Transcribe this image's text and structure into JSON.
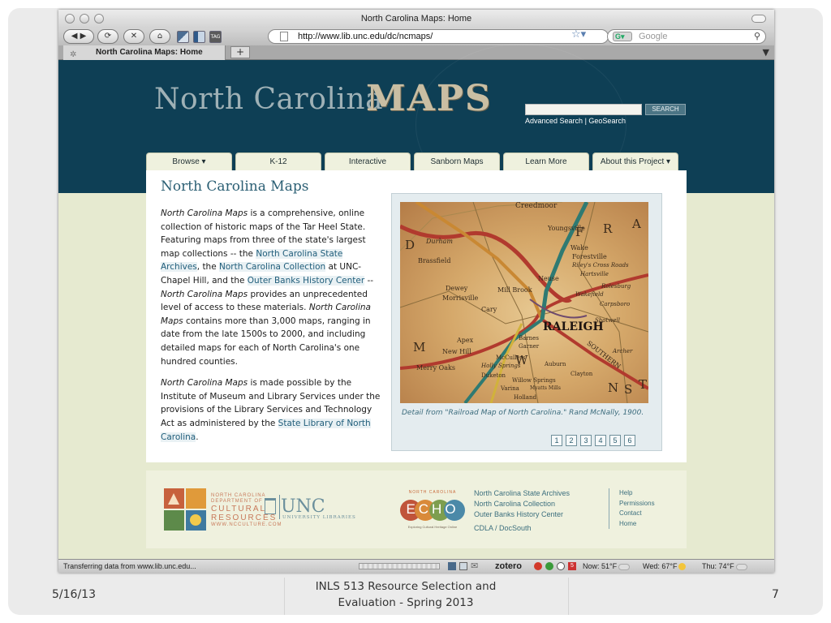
{
  "browser": {
    "window_title": "North Carolina Maps: Home",
    "url": "http://www.lib.unc.edu/dc/ncmaps/",
    "search_placeholder": "Google",
    "tab_title": "North Carolina Maps: Home",
    "new_tab_label": "+"
  },
  "header": {
    "logo_text": "North Carolina",
    "logo_maps": "MAPS",
    "search_button": "SEARCH",
    "advanced_search": "Advanced Search",
    "separator": "|",
    "geosearch": "GeoSearch"
  },
  "nav": {
    "tabs": [
      {
        "label": "Browse ▾"
      },
      {
        "label": "K-12"
      },
      {
        "label": "Interactive"
      },
      {
        "label": "Sanborn Maps"
      },
      {
        "label": "Learn More"
      },
      {
        "label": "About this Project ▾"
      }
    ]
  },
  "main": {
    "title": "North Carolina Maps",
    "p1_s1_i": "North Carolina Maps",
    "p1_s1": " is a comprehensive, online collection of historic maps of the Tar Heel State. Featuring maps from three of the state's largest map collections -- the ",
    "link_archives": "North Carolina State Archives",
    "p1_s2": ", the ",
    "link_collection": "North Carolina Collection",
    "p1_s3": " at UNC-Chapel Hill, and the ",
    "link_outer": "Outer Banks History Center",
    "p1_s4": " -- ",
    "p1_s4_i": "North Carolina Maps",
    "p1_s5": " provides an unprecedented level of access to these materials. ",
    "p1_s5_i": "North Carolina Maps",
    "p1_s6": " contains more than 3,000 maps, ranging in date from the late 1500s to 2000, and including detailed maps for each of North Carolina's one hundred counties.",
    "p2_s1_i": "North Carolina Maps",
    "p2_s1": " is made possible by the Institute of Museum and Library Services under the provisions of the Library Services and Technology Act as administered by the ",
    "link_state_lib": "State Library of North Carolina",
    "p2_end": ".",
    "map_caption": "Detail from \"Railroad Map of North Carolina.\" Rand McNally, 1900.",
    "pages": [
      "1",
      "2",
      "3",
      "4",
      "5",
      "6"
    ],
    "map_labels": [
      "Creedmoor",
      "Youngsville",
      "Wake",
      "Forestville",
      "Riley's Cross Roads",
      "Hartsville",
      "Brassfield",
      "Neuse",
      "Durham",
      "Dewey",
      "Mill Brook",
      "Morrisville",
      "Wakefield",
      "Rolesburg",
      "Carpsboro",
      "Cary",
      "RALEIGH",
      "Shotwell",
      "Apex",
      "Barnes",
      "Garner",
      "New Hill",
      "McCullers",
      "Holly Springs",
      "Merry Oaks",
      "Duketon",
      "Willow Springs",
      "Auburn",
      "Clayton",
      "Varina",
      "Myatts Mills",
      "Holland",
      "SOUTHERN",
      "Archer",
      "F",
      "R",
      "A",
      "W",
      "M",
      "N",
      "S",
      "T",
      "D"
    ]
  },
  "footer": {
    "ncdcr_lines": [
      "NORTH CAROLINA",
      "DEPARTMENT OF",
      "CULTURAL",
      "RESOURCES",
      "WWW.NCCULTURE.COM"
    ],
    "unc": "UNC",
    "unc_sub": "UNIVERSITY LIBRARIES",
    "echo_top": "NORTH CAROLINA",
    "echo": "ECHO",
    "echo_sub": "Exploring Cultural Heritage Online",
    "links": [
      "North Carolina State Archives",
      "North Carolina Collection",
      "Outer Banks History Center",
      "CDLA / DocSouth"
    ],
    "help_links": [
      "Help",
      "Permissions",
      "Contact",
      "Home"
    ]
  },
  "status": {
    "text": "Transferring data from www.lib.unc.edu...",
    "zotero": "zotero",
    "weather_now": "Now: 51°F",
    "weather_wed": "Wed: 67°F",
    "weather_thu": "Thu: 74°F"
  },
  "slide": {
    "date": "5/16/13",
    "course_line1": "INLS 513 Resource Selection and",
    "course_line2": "Evaluation - Spring 2013",
    "page_number": "7"
  },
  "colors": {
    "header_bg": "#0e3f55",
    "page_bg": "#e6ead0",
    "link": "#215e7b",
    "title": "#2b5f74"
  }
}
